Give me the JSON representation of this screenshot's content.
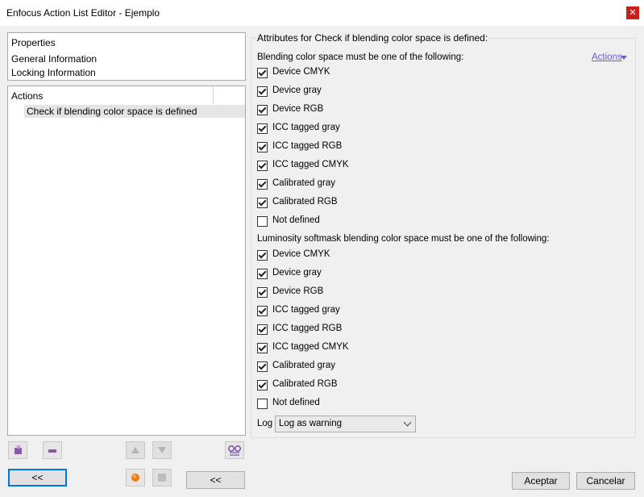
{
  "window": {
    "title": "Enfocus Action List Editor - Ejemplo",
    "close_icon": "close-icon"
  },
  "properties": {
    "header": "Properties",
    "items": [
      "General Information",
      "Locking Information"
    ]
  },
  "actions_panel": {
    "header": "Actions",
    "items": [
      "Check if blending color space is defined"
    ]
  },
  "attributes": {
    "group_title": "Attributes for Check if blending color space is defined:",
    "actions_link": "Actions",
    "blending": {
      "label": "Blending color space must be one of the following:",
      "options": [
        {
          "label": "Device CMYK",
          "checked": true
        },
        {
          "label": "Device gray",
          "checked": true
        },
        {
          "label": "Device RGB",
          "checked": true
        },
        {
          "label": "ICC tagged gray",
          "checked": true
        },
        {
          "label": "ICC tagged RGB",
          "checked": true
        },
        {
          "label": "ICC tagged CMYK",
          "checked": true
        },
        {
          "label": "Calibrated gray",
          "checked": true
        },
        {
          "label": "Calibrated RGB",
          "checked": true
        },
        {
          "label": "Not defined",
          "checked": false
        }
      ]
    },
    "softmask": {
      "label": "Luminosity softmask blending color space must be one of the following:",
      "options": [
        {
          "label": "Device CMYK",
          "checked": true
        },
        {
          "label": "Device gray",
          "checked": true
        },
        {
          "label": "Device RGB",
          "checked": true
        },
        {
          "label": "ICC tagged gray",
          "checked": true
        },
        {
          "label": "ICC tagged RGB",
          "checked": true
        },
        {
          "label": "ICC tagged CMYK",
          "checked": true
        },
        {
          "label": "Calibrated gray",
          "checked": true
        },
        {
          "label": "Calibrated RGB",
          "checked": true
        },
        {
          "label": "Not defined",
          "checked": false
        }
      ]
    },
    "log": {
      "label": "Log",
      "value": "Log as warning"
    }
  },
  "buttons": {
    "collapse_left": "<<",
    "collapse_mid": "<<",
    "ok": "Aceptar",
    "cancel": "Cancelar"
  }
}
